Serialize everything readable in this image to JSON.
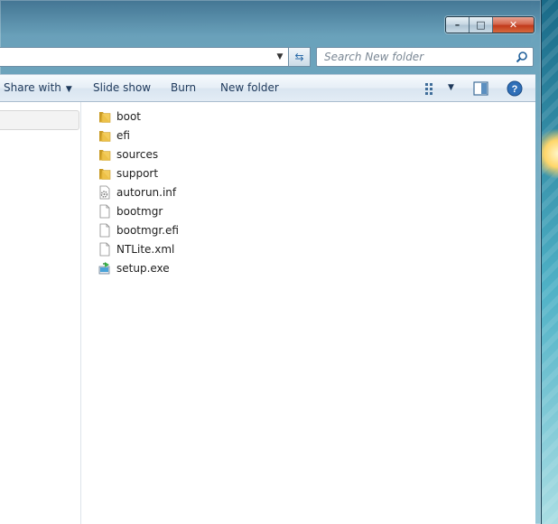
{
  "address": {
    "dropdown_icon": "chevron-down-icon",
    "refresh_icon": "refresh-icon"
  },
  "search": {
    "placeholder": "Search New folder",
    "icon": "search-icon"
  },
  "window_controls": {
    "minimize_glyph": "–",
    "maximize_glyph": "□",
    "close_glyph": "✕"
  },
  "toolbar": {
    "share_with_label": "Share with",
    "slide_show_label": "Slide show",
    "burn_label": "Burn",
    "new_folder_label": "New folder",
    "dropdown_glyph": "▼"
  },
  "files": [
    {
      "name": "boot",
      "type": "folder"
    },
    {
      "name": "efi",
      "type": "folder"
    },
    {
      "name": "sources",
      "type": "folder"
    },
    {
      "name": "support",
      "type": "folder"
    },
    {
      "name": "autorun.inf",
      "type": "settings-file"
    },
    {
      "name": "bootmgr",
      "type": "file"
    },
    {
      "name": "bootmgr.efi",
      "type": "file"
    },
    {
      "name": "NTLite.xml",
      "type": "file"
    },
    {
      "name": "setup.exe",
      "type": "installer"
    }
  ],
  "colors": {
    "accent": "#1e395b",
    "folder": "#e8b830",
    "help": "#2f6fb8"
  }
}
